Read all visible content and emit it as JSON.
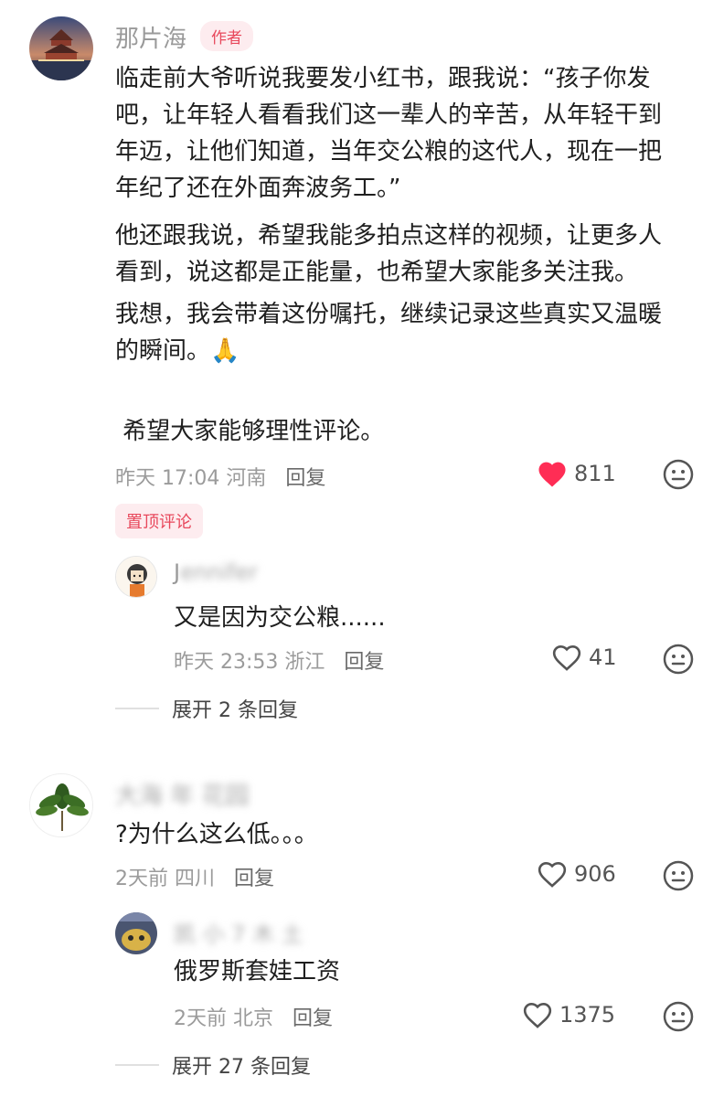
{
  "comments": [
    {
      "author": "那片海",
      "badge": "作者",
      "paragraphs": [
        "临走前大爷听说我要发小红书，跟我说：“孩子你发\n吧，让年轻人看看我们这一辈人的辛苦，从年轻干到\n年迈，让他们知道，当年交公粮的这代人，现在一把\n年纪了还在外面奔波务工。”",
        "他还跟我说，希望我能多拍点这样的视频，让更多人\n看到，说这都是正能量，也希望大家能多关注我。",
        "我想，我会带着这份嘱托，继续记录这些真实又温暖\n的瞬间。🙏",
        " 希望大家能够理性评论。"
      ],
      "time": "昨天 17:04",
      "location": "河南",
      "reply_label": "回复",
      "likes": "811",
      "liked": true,
      "pinned_label": "置顶评论",
      "replies": [
        {
          "author": "J",
          "author_blurred": "ennifer",
          "text": "又是因为交公粮......",
          "time": "昨天 23:53",
          "location": "浙江",
          "reply_label": "回复",
          "likes": "41"
        }
      ],
      "expand_label": "展开 2 条回复"
    },
    {
      "author": "",
      "author_blurred": "大海 年 花园",
      "text": "?为什么这么低。。。",
      "time": "2天前",
      "location": "四川",
      "reply_label": "回复",
      "likes": "906",
      "replies": [
        {
          "author": "",
          "author_blurred": "凯 小 7 木 土",
          "text": "俄罗斯套娃工资",
          "time": "2天前",
          "location": "北京",
          "reply_label": "回复",
          "likes": "1375"
        }
      ],
      "expand_label": "展开 27 条回复"
    }
  ],
  "icons": {
    "heart_filled_color": "#ff2d55",
    "heart_outline_color": "#555555",
    "emoji": "emoji-face-icon"
  }
}
